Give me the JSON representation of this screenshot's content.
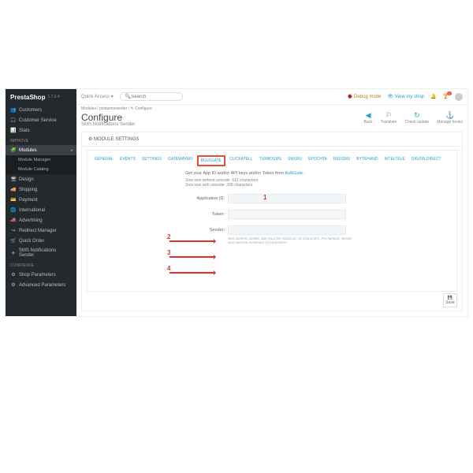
{
  "logo": {
    "brand": "PrestaShop",
    "version": "1.7.6.4"
  },
  "topbar": {
    "quick": "Quick Access ▾",
    "search_placeholder": "Search",
    "debug": "Debug mode",
    "view": "View my shop",
    "notif_count": "7"
  },
  "sidebar": {
    "top": [
      {
        "icon": "👥",
        "label": "Customers"
      },
      {
        "icon": "🎧",
        "label": "Customer Service"
      },
      {
        "icon": "📊",
        "label": "Stats"
      }
    ],
    "improve_title": "IMPROVE",
    "improve": [
      {
        "icon": "🧩",
        "label": "Modules",
        "sel": true
      },
      {
        "icon": "🖥",
        "label": "Design"
      },
      {
        "icon": "🚚",
        "label": "Shipping"
      },
      {
        "icon": "💳",
        "label": "Payment"
      },
      {
        "icon": "🌐",
        "label": "International"
      },
      {
        "icon": "📣",
        "label": "Advertising"
      },
      {
        "icon": "↪",
        "label": "Redirect Manager"
      },
      {
        "icon": "🛒",
        "label": "Quick Order"
      },
      {
        "icon": "✈",
        "label": "SMS Notifications Sender"
      }
    ],
    "modsub": [
      "Module Manager",
      "Module Catalog"
    ],
    "configure_title": "CONFIGURE",
    "configure": [
      {
        "icon": "⚙",
        "label": "Shop Parameters"
      },
      {
        "icon": "⚙",
        "label": "Advanced Parameters"
      }
    ]
  },
  "crumb": "Modules  /  pintasmssender  /  ✎ Configure",
  "title": "Configure",
  "subtitle": "SMS Notifications Sender",
  "actions": [
    {
      "icon": "◀",
      "label": "Back"
    },
    {
      "icon": "⚐",
      "label": "Translate"
    },
    {
      "icon": "↻",
      "label": "Check update"
    },
    {
      "icon": "⚓",
      "label": "Manage hooks"
    }
  ],
  "panel_title": "MODULE SETTINGS",
  "tabs": [
    "GENERAL",
    "EVENTS",
    "SETTINGS",
    "GATEWAYAPI",
    "BULKGATE",
    "CLICKATELL",
    "TURBOSMS",
    "SMSRU",
    "EPOCHTA",
    "REDSMS",
    "BYTEHAND",
    "INTELTELE",
    "DIGITALDIRECT"
  ],
  "active_tab": 4,
  "form": {
    "intro_a": "Get your App ID and/or API keys and/or Token from ",
    "intro_link": "BulkGate",
    "hint1": "Sms size without unicode: 612 characters",
    "hint2": "Sms size with unicode: 268 characters",
    "rows": [
      {
        "label": "Application ID:"
      },
      {
        "label": "Token:"
      },
      {
        "label": "Sender:"
      }
    ],
    "note": "Non numeric sender size must be maximum 11 characters. For numeric sender size must be maximum 15 characters."
  },
  "save": "Save",
  "annot": {
    "a1": "1",
    "a2": "2",
    "a3": "3",
    "a4": "4"
  }
}
